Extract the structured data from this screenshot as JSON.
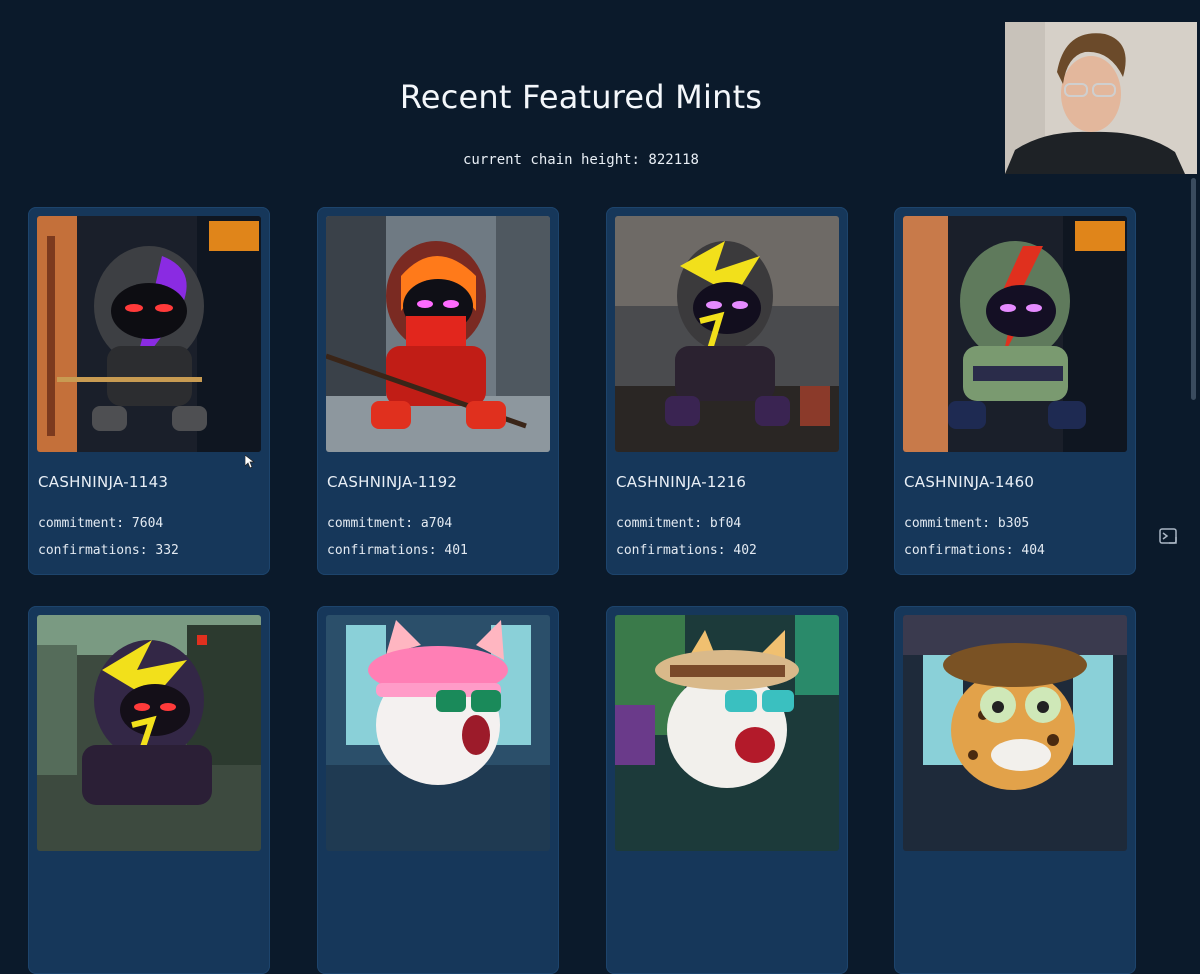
{
  "header": {
    "title": "Recent Featured Mints",
    "chain_height": "current chain height: 822118"
  },
  "cards": [
    {
      "name": "CASHNINJA-1143",
      "commitment": "commitment: 7604",
      "confirmations": "confirmations: 332"
    },
    {
      "name": "CASHNINJA-1192",
      "commitment": "commitment: a704",
      "confirmations": "confirmations: 401"
    },
    {
      "name": "CASHNINJA-1216",
      "commitment": "commitment: bf04",
      "confirmations": "confirmations: 402"
    },
    {
      "name": "CASHNINJA-1460",
      "commitment": "commitment: b305",
      "confirmations": "confirmations: 404"
    },
    {
      "name": "",
      "commitment": "",
      "confirmations": ""
    },
    {
      "name": "",
      "commitment": "",
      "confirmations": ""
    },
    {
      "name": "",
      "commitment": "",
      "confirmations": ""
    },
    {
      "name": "",
      "commitment": "",
      "confirmations": ""
    }
  ],
  "icons": {
    "side_button": "terminal-icon",
    "cursor": "mouse-pointer-icon"
  },
  "colors": {
    "background": "#0b1a2b",
    "card": "#16375a",
    "accent_purple": "#8a2be2",
    "accent_orange": "#ff7a1a",
    "accent_yellow": "#f2e01b",
    "accent_red": "#e0301e"
  }
}
